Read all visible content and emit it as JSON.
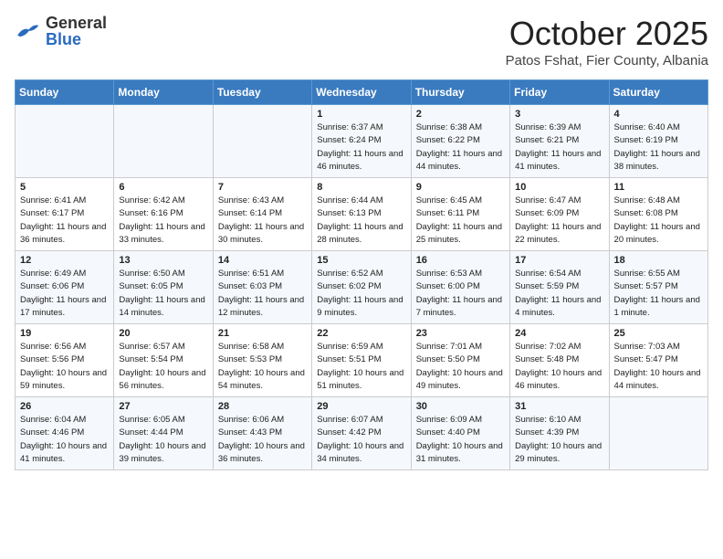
{
  "header": {
    "logo": {
      "general": "General",
      "blue": "Blue"
    },
    "title": "October 2025",
    "subtitle": "Patos Fshat, Fier County, Albania"
  },
  "days_of_week": [
    "Sunday",
    "Monday",
    "Tuesday",
    "Wednesday",
    "Thursday",
    "Friday",
    "Saturday"
  ],
  "weeks": [
    [
      {
        "day": "",
        "info": ""
      },
      {
        "day": "",
        "info": ""
      },
      {
        "day": "",
        "info": ""
      },
      {
        "day": "1",
        "info": "Sunrise: 6:37 AM\nSunset: 6:24 PM\nDaylight: 11 hours and 46 minutes."
      },
      {
        "day": "2",
        "info": "Sunrise: 6:38 AM\nSunset: 6:22 PM\nDaylight: 11 hours and 44 minutes."
      },
      {
        "day": "3",
        "info": "Sunrise: 6:39 AM\nSunset: 6:21 PM\nDaylight: 11 hours and 41 minutes."
      },
      {
        "day": "4",
        "info": "Sunrise: 6:40 AM\nSunset: 6:19 PM\nDaylight: 11 hours and 38 minutes."
      }
    ],
    [
      {
        "day": "5",
        "info": "Sunrise: 6:41 AM\nSunset: 6:17 PM\nDaylight: 11 hours and 36 minutes."
      },
      {
        "day": "6",
        "info": "Sunrise: 6:42 AM\nSunset: 6:16 PM\nDaylight: 11 hours and 33 minutes."
      },
      {
        "day": "7",
        "info": "Sunrise: 6:43 AM\nSunset: 6:14 PM\nDaylight: 11 hours and 30 minutes."
      },
      {
        "day": "8",
        "info": "Sunrise: 6:44 AM\nSunset: 6:13 PM\nDaylight: 11 hours and 28 minutes."
      },
      {
        "day": "9",
        "info": "Sunrise: 6:45 AM\nSunset: 6:11 PM\nDaylight: 11 hours and 25 minutes."
      },
      {
        "day": "10",
        "info": "Sunrise: 6:47 AM\nSunset: 6:09 PM\nDaylight: 11 hours and 22 minutes."
      },
      {
        "day": "11",
        "info": "Sunrise: 6:48 AM\nSunset: 6:08 PM\nDaylight: 11 hours and 20 minutes."
      }
    ],
    [
      {
        "day": "12",
        "info": "Sunrise: 6:49 AM\nSunset: 6:06 PM\nDaylight: 11 hours and 17 minutes."
      },
      {
        "day": "13",
        "info": "Sunrise: 6:50 AM\nSunset: 6:05 PM\nDaylight: 11 hours and 14 minutes."
      },
      {
        "day": "14",
        "info": "Sunrise: 6:51 AM\nSunset: 6:03 PM\nDaylight: 11 hours and 12 minutes."
      },
      {
        "day": "15",
        "info": "Sunrise: 6:52 AM\nSunset: 6:02 PM\nDaylight: 11 hours and 9 minutes."
      },
      {
        "day": "16",
        "info": "Sunrise: 6:53 AM\nSunset: 6:00 PM\nDaylight: 11 hours and 7 minutes."
      },
      {
        "day": "17",
        "info": "Sunrise: 6:54 AM\nSunset: 5:59 PM\nDaylight: 11 hours and 4 minutes."
      },
      {
        "day": "18",
        "info": "Sunrise: 6:55 AM\nSunset: 5:57 PM\nDaylight: 11 hours and 1 minute."
      }
    ],
    [
      {
        "day": "19",
        "info": "Sunrise: 6:56 AM\nSunset: 5:56 PM\nDaylight: 10 hours and 59 minutes."
      },
      {
        "day": "20",
        "info": "Sunrise: 6:57 AM\nSunset: 5:54 PM\nDaylight: 10 hours and 56 minutes."
      },
      {
        "day": "21",
        "info": "Sunrise: 6:58 AM\nSunset: 5:53 PM\nDaylight: 10 hours and 54 minutes."
      },
      {
        "day": "22",
        "info": "Sunrise: 6:59 AM\nSunset: 5:51 PM\nDaylight: 10 hours and 51 minutes."
      },
      {
        "day": "23",
        "info": "Sunrise: 7:01 AM\nSunset: 5:50 PM\nDaylight: 10 hours and 49 minutes."
      },
      {
        "day": "24",
        "info": "Sunrise: 7:02 AM\nSunset: 5:48 PM\nDaylight: 10 hours and 46 minutes."
      },
      {
        "day": "25",
        "info": "Sunrise: 7:03 AM\nSunset: 5:47 PM\nDaylight: 10 hours and 44 minutes."
      }
    ],
    [
      {
        "day": "26",
        "info": "Sunrise: 6:04 AM\nSunset: 4:46 PM\nDaylight: 10 hours and 41 minutes."
      },
      {
        "day": "27",
        "info": "Sunrise: 6:05 AM\nSunset: 4:44 PM\nDaylight: 10 hours and 39 minutes."
      },
      {
        "day": "28",
        "info": "Sunrise: 6:06 AM\nSunset: 4:43 PM\nDaylight: 10 hours and 36 minutes."
      },
      {
        "day": "29",
        "info": "Sunrise: 6:07 AM\nSunset: 4:42 PM\nDaylight: 10 hours and 34 minutes."
      },
      {
        "day": "30",
        "info": "Sunrise: 6:09 AM\nSunset: 4:40 PM\nDaylight: 10 hours and 31 minutes."
      },
      {
        "day": "31",
        "info": "Sunrise: 6:10 AM\nSunset: 4:39 PM\nDaylight: 10 hours and 29 minutes."
      },
      {
        "day": "",
        "info": ""
      }
    ]
  ]
}
